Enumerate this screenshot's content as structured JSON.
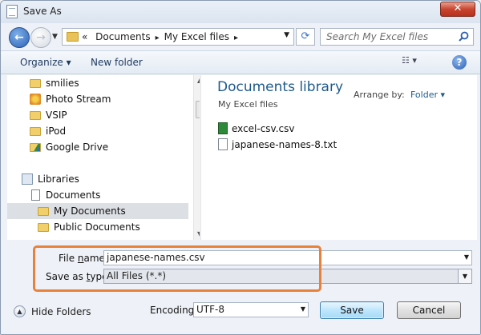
{
  "window": {
    "title": "Save As",
    "close_glyph": "✕"
  },
  "nav": {
    "address_parts": [
      "«",
      "Documents",
      "My Excel files"
    ],
    "separator": "▸",
    "search_placeholder": "Search My Excel files"
  },
  "toolbar": {
    "organize_label": "Organize ▾",
    "new_folder_label": "New folder"
  },
  "navpane": {
    "items": [
      {
        "label": "smilies",
        "icon": "folder-icon"
      },
      {
        "label": "Photo Stream",
        "icon": "photo-stream-icon"
      },
      {
        "label": "VSIP",
        "icon": "folder-icon"
      },
      {
        "label": "iPod",
        "icon": "folder-icon"
      },
      {
        "label": "Google Drive",
        "icon": "google-drive-icon"
      },
      {
        "label": "Libraries",
        "icon": "libraries-icon"
      },
      {
        "label": "Documents",
        "icon": "documents-icon"
      },
      {
        "label": "My Documents",
        "icon": "folder-icon",
        "selected": true
      },
      {
        "label": "Public Documents",
        "icon": "folder-icon"
      }
    ]
  },
  "content": {
    "library_title": "Documents library",
    "library_subtitle": "My Excel files",
    "arrange_by_label": "Arrange by:",
    "arrange_by_value": "Folder ▾",
    "files": [
      {
        "name": "excel-csv.csv",
        "icon": "excel-file-icon"
      },
      {
        "name": "japanese-names-8.txt",
        "icon": "text-file-icon"
      }
    ]
  },
  "form": {
    "file_name_label_pre": "File ",
    "file_name_label_u": "n",
    "file_name_label_post": "ame:",
    "file_name_value": "japanese-names.csv",
    "save_type_label_pre": "Save as ",
    "save_type_label_u": "t",
    "save_type_label_post": "ype:",
    "save_type_value": "All Files  (*.*)",
    "encoding_label": "Encoding:",
    "encoding_value": "UTF-8"
  },
  "footer": {
    "hide_folders_label": "Hide Folders",
    "save_label": "Save",
    "cancel_label": "Cancel"
  },
  "colors": {
    "accent": "#1e5a8a",
    "highlight": "#e8823a",
    "selection": "#dcdfe4"
  }
}
